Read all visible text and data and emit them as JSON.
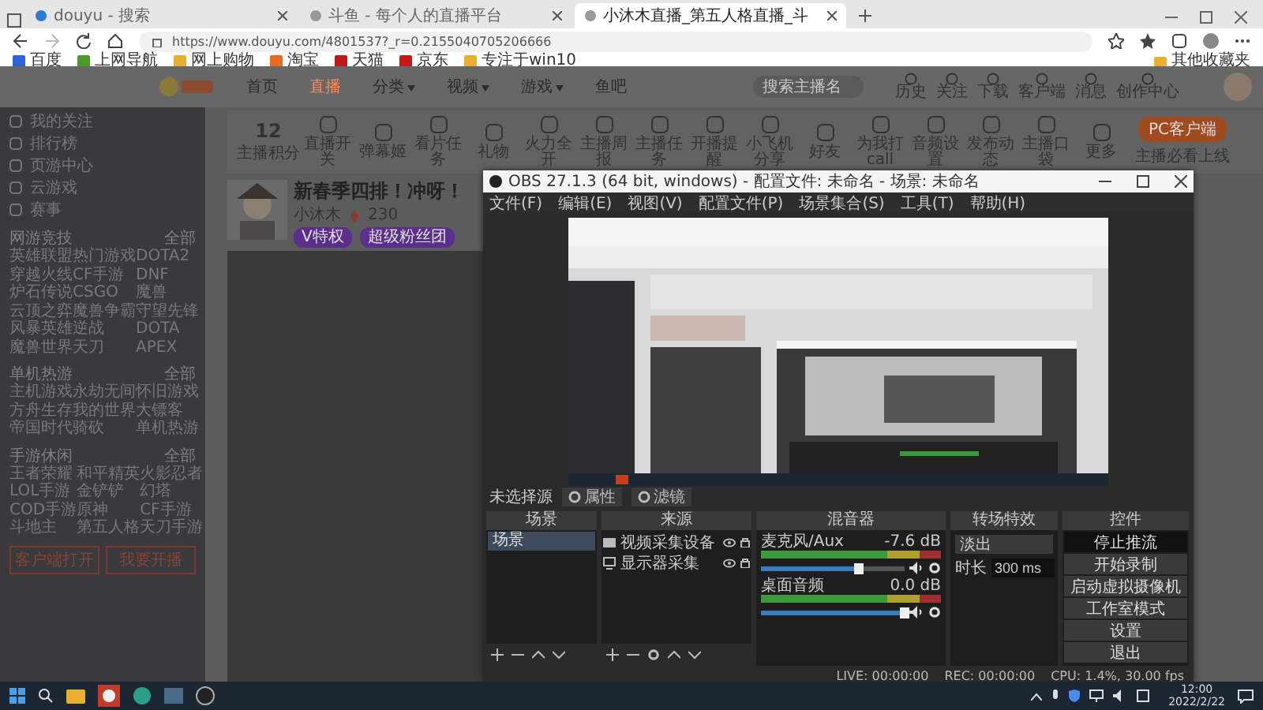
{
  "browser": {
    "tabs": [
      {
        "title": "douyu - 搜索",
        "selected": false
      },
      {
        "title": "斗鱼 - 每个人的直播平台",
        "selected": false
      },
      {
        "title": "小沐木直播_第五人格直播_斗",
        "selected": true
      }
    ],
    "url": "https://www.douyu.com/4801537?_r=0.2155040705206666",
    "bookmarks": [
      "百度",
      "上网导航",
      "网上购物",
      "淘宝",
      "天猫",
      "京东",
      "专注于win10"
    ],
    "other_bookmarks": "其他收藏夹"
  },
  "site": {
    "nav": [
      {
        "label": "首页",
        "selected": false,
        "dropdown": false
      },
      {
        "label": "直播",
        "selected": true,
        "dropdown": false
      },
      {
        "label": "分类",
        "selected": false,
        "dropdown": true
      },
      {
        "label": "视频",
        "selected": false,
        "dropdown": true
      },
      {
        "label": "游戏",
        "selected": false,
        "dropdown": true
      },
      {
        "label": "鱼吧",
        "selected": false,
        "dropdown": false
      }
    ],
    "search_placeholder": "搜索主播名",
    "header_links": [
      "历史",
      "关注",
      "下载",
      "客户端",
      "消息",
      "创作中心"
    ],
    "sidebar": {
      "items": [
        "我的关注",
        "排行榜",
        "页游中心",
        "云游戏",
        "赛事"
      ],
      "sections": [
        {
          "title": "网游竞技",
          "more": "全部",
          "games": [
            "英雄联盟",
            "热门游戏",
            "DOTA2",
            "穿越火线",
            "CF手游",
            "DNF",
            "炉石传说",
            "CSGO",
            "魔兽",
            "云顶之弈",
            "魔兽争霸",
            "守望先锋",
            "风暴英雄",
            "逆战",
            "DOTA",
            "魔兽世界",
            "天刀",
            "APEX"
          ]
        },
        {
          "title": "单机热游",
          "more": "全部",
          "games": [
            "主机游戏",
            "永劫无间",
            "怀旧游戏",
            "方舟生存",
            "我的世界",
            "大镖客",
            "帝国时代",
            "骑砍",
            "单机热游"
          ]
        },
        {
          "title": "手游休闲",
          "more": "全部",
          "games": [
            "王者荣耀",
            "和平精英",
            "火影忍者",
            "LOL手游",
            "金铲铲",
            "幻塔",
            "COD手游",
            "原神",
            "CF手游",
            "斗地主",
            "第五人格",
            "天刀手游"
          ]
        }
      ],
      "buttons": [
        "客户端打开",
        "我要开播"
      ]
    },
    "toolbar": {
      "score": "12",
      "score_label": "主播积分",
      "tools": [
        "直播开关",
        "弹幕姬",
        "看片任务",
        "礼物",
        "火力全开",
        "主播周报",
        "主播任务",
        "开播提醒",
        "小飞机分享",
        "好友",
        "为我打call",
        "音频设置",
        "发布动态",
        "主播口袋",
        "更多"
      ],
      "pc_button": "PC客户端",
      "pc_caption": "主播必看上线"
    },
    "room": {
      "title": "新春季四排！冲呀！",
      "streamer": "小沐木",
      "hot": "230",
      "tags": [
        "V特权",
        "超级粉丝团"
      ]
    }
  },
  "obs": {
    "title": "OBS 27.1.3 (64 bit, windows) - 配置文件: 未命名 - 场景: 未命名",
    "menu": [
      "文件(F)",
      "编辑(E)",
      "视图(V)",
      "配置文件(P)",
      "场景集合(S)",
      "工具(T)",
      "帮助(H)"
    ],
    "source_bar": {
      "label": "未选择源",
      "buttons": [
        "属性",
        "滤镜"
      ]
    },
    "scenes": {
      "title": "场景",
      "items": [
        {
          "label": "场景",
          "selected": true
        }
      ]
    },
    "sources": {
      "title": "来源",
      "items": [
        {
          "label": "视频采集设备",
          "kind": "camera"
        },
        {
          "label": "显示器采集",
          "kind": "monitor"
        }
      ]
    },
    "mixer": {
      "title": "混音器",
      "channels": [
        {
          "name": "麦克风/Aux",
          "reading": "-7.6 dB",
          "level": 0.68
        },
        {
          "name": "桌面音频",
          "reading": "0.0 dB",
          "level": 1.0
        }
      ]
    },
    "transitions": {
      "title": "转场特效",
      "effect": "淡出",
      "duration_label": "时长",
      "duration": "300 ms"
    },
    "controls": {
      "title": "控件",
      "buttons": [
        {
          "label": "停止推流",
          "selected": true
        },
        {
          "label": "开始录制",
          "selected": false
        },
        {
          "label": "启动虚拟摄像机",
          "selected": false
        },
        {
          "label": "工作室模式",
          "selected": false
        },
        {
          "label": "设置",
          "selected": false
        },
        {
          "label": "退出",
          "selected": false
        }
      ]
    },
    "status": [
      "LIVE: 00:00:00",
      "REC: 00:00:00",
      "CPU: 1.4%, 30.00 fps"
    ]
  },
  "taskbar": {
    "time": "12:00",
    "date": "2022/2/22"
  }
}
